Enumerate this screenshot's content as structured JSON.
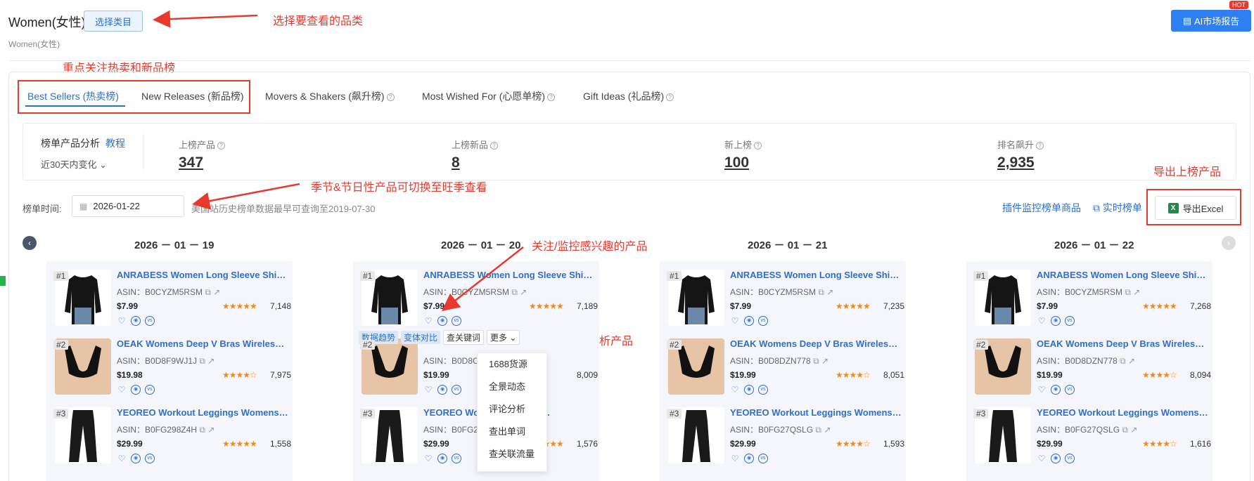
{
  "header": {
    "category_title": "Women(女性)",
    "select_category_label": "选择类目",
    "breadcrumb": "Women(女性)",
    "ai_report_label": "AI市场报告",
    "hot_badge": "HOT"
  },
  "annotations": {
    "select_category": "选择要查看的品类",
    "focus_lists": "重点关注热卖和新品榜",
    "seasonal": "季节&节日性产品可切换至旺季查看",
    "export": "导出上榜产品",
    "follow": "关注/监控感兴趣的产品",
    "quick_analysis": "快速分析产品"
  },
  "tabs": [
    {
      "label": "Best Sellers (热卖榜)",
      "active": true
    },
    {
      "label": "New Releases (新品榜)"
    },
    {
      "label": "Movers & Shakers (飙升榜)"
    },
    {
      "label": "Most Wished For (心愿单榜)"
    },
    {
      "label": "Gift Ideas (礼品榜)"
    }
  ],
  "stats": {
    "analysis_label": "榜单产品分析",
    "tutorial_label": "教程",
    "period_label": "近30天内变化",
    "items": [
      {
        "label": "上榜产品",
        "value": "347"
      },
      {
        "label": "上榜新品",
        "value": "8"
      },
      {
        "label": "新上榜",
        "value": "100"
      },
      {
        "label": "排名飙升",
        "value": "2,935"
      }
    ]
  },
  "toolbar": {
    "date_label": "榜单时间:",
    "date_value": "2026-01-22",
    "date_note": "美国站历史榜单数据最早可查询至2019-07-30",
    "plugin_link": "插件监控榜单商品",
    "realtime_link": "实时榜单",
    "export_label": "导出Excel"
  },
  "columns": [
    {
      "date": "2026 － 01 － 19",
      "products": [
        {
          "rank": "#1",
          "name": "ANRABESS Women Long Sleeve Shirts...",
          "asin": "ASIN：B0CYZM5RSM",
          "price": "$7.99",
          "stars": "★★★★★",
          "reviews": "7,148"
        },
        {
          "rank": "#2",
          "name": "OEAK Womens Deep V Bras Wireless ...",
          "asin": "ASIN：B0D8F9WJ1J",
          "price": "$19.98",
          "stars": "★★★★☆",
          "reviews": "7,975"
        },
        {
          "rank": "#3",
          "name": "YEOREO Workout Leggings Womens N...",
          "asin": "ASIN：B0FG298Z4H",
          "price": "$29.99",
          "stars": "★★★★★",
          "reviews": "1,558"
        }
      ]
    },
    {
      "date": "2026 － 01 － 20",
      "products": [
        {
          "rank": "#1",
          "name": "ANRABESS Women Long Sleeve Shirts...",
          "asin": "ASIN：B0CYZM5RSM",
          "price": "$7.99",
          "stars": "★★★★★",
          "reviews": "7,189"
        },
        {
          "rank": "#2",
          "name": "",
          "asin": "ASIN：B0D8C",
          "price": "$19.99",
          "stars": "★",
          "reviews": "8,009"
        },
        {
          "rank": "#3",
          "name": "YEOREO Wo",
          "name2": "mens N...",
          "asin": "ASIN：B0FG2",
          "price": "$29.99",
          "stars": "★★★★★",
          "reviews": "1,576"
        }
      ]
    },
    {
      "date": "2026 － 01 － 21",
      "products": [
        {
          "rank": "#1",
          "name": "ANRABESS Women Long Sleeve Shirts...",
          "asin": "ASIN：B0CYZM5RSM",
          "price": "$7.99",
          "stars": "★★★★★",
          "reviews": "7,235"
        },
        {
          "rank": "#2",
          "name": "OEAK Womens Deep V Bras Wireless ...",
          "asin": "ASIN：B0D8DZN778",
          "price": "$19.99",
          "stars": "★★★★☆",
          "reviews": "8,051"
        },
        {
          "rank": "#3",
          "name": "YEOREO Workout Leggings Womens N...",
          "asin": "ASIN：B0FG27QSLG",
          "price": "$29.99",
          "stars": "★★★★☆",
          "reviews": "1,593"
        }
      ]
    },
    {
      "date": "2026 － 01 － 22",
      "products": [
        {
          "rank": "#1",
          "name": "ANRABESS Women Long Sleeve Shirts...",
          "asin": "ASIN：B0CYZM5RSM",
          "price": "$7.99",
          "stars": "★★★★★",
          "reviews": "7,268"
        },
        {
          "rank": "#2",
          "name": "OEAK Womens Deep V Bras Wireless ...",
          "asin": "ASIN：B0D8DZN778",
          "price": "$19.99",
          "stars": "★★★★☆",
          "reviews": "8,094"
        },
        {
          "rank": "#3",
          "name": "YEOREO Workout Leggings Womens N...",
          "asin": "ASIN：B0FG27QSLG",
          "price": "$29.99",
          "stars": "★★★★☆",
          "reviews": "1,616"
        }
      ]
    }
  ],
  "quick_actions": {
    "trend": "数据趋势",
    "variant": "变体对比",
    "keywords": "查关键词",
    "more": "更多"
  },
  "more_menu": [
    "1688货源",
    "全景动态",
    "评论分析",
    "查出单词",
    "查关联流量"
  ],
  "colors": {
    "accent": "#2d6fd0",
    "annotation": "#e8392c",
    "star": "#f08a1c"
  }
}
